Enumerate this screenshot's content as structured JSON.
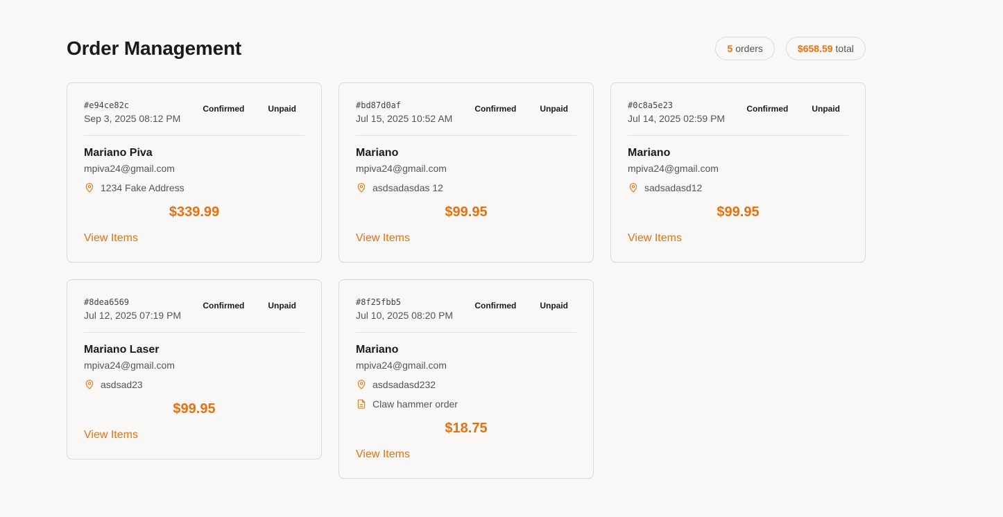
{
  "page": {
    "title": "Order Management",
    "accent_color": "#e8700f"
  },
  "stats": {
    "orders_count": "5",
    "orders_label": "orders",
    "total_amount": "$658.59",
    "total_label": "total"
  },
  "orders": [
    {
      "id": "#e94ce82c",
      "date": "Sep 3, 2025  08:12 PM",
      "status": "Confirmed",
      "payment": "Unpaid",
      "customer_name": "Mariano Piva",
      "email": "mpiva24@gmail.com",
      "address": "1234 Fake Address",
      "note": null,
      "amount": "$339.99",
      "view_items_label": "View Items"
    },
    {
      "id": "#bd87d0af",
      "date": "Jul 15, 2025  10:52 AM",
      "status": "Confirmed",
      "payment": "Unpaid",
      "customer_name": "Mariano",
      "email": "mpiva24@gmail.com",
      "address": "asdsadasdas 12",
      "note": null,
      "amount": "$99.95",
      "view_items_label": "View Items"
    },
    {
      "id": "#0c8a5e23",
      "date": "Jul 14, 2025  02:59 PM",
      "status": "Confirmed",
      "payment": "Unpaid",
      "customer_name": "Mariano",
      "email": "mpiva24@gmail.com",
      "address": "sadsadasd12",
      "note": null,
      "amount": "$99.95",
      "view_items_label": "View Items"
    },
    {
      "id": "#8dea6569",
      "date": "Jul 12, 2025  07:19 PM",
      "status": "Confirmed",
      "payment": "Unpaid",
      "customer_name": "Mariano Laser",
      "email": "mpiva24@gmail.com",
      "address": "asdsad23",
      "note": null,
      "amount": "$99.95",
      "view_items_label": "View Items"
    },
    {
      "id": "#8f25fbb5",
      "date": "Jul 10, 2025  08:20 PM",
      "status": "Confirmed",
      "payment": "Unpaid",
      "customer_name": "Mariano",
      "email": "mpiva24@gmail.com",
      "address": "asdsadasd232",
      "note": "Claw hammer order",
      "amount": "$18.75",
      "view_items_label": "View Items"
    }
  ],
  "icons": {
    "address": "map-pin-icon",
    "note": "file-text-icon"
  }
}
